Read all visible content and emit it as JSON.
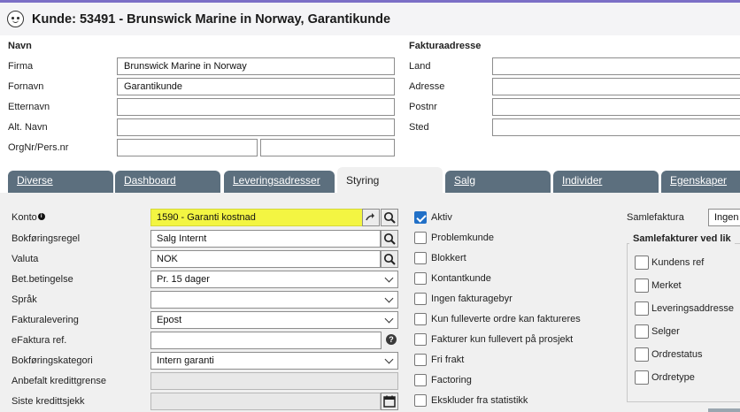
{
  "title": "Kunde: 53491 - Brunswick Marine in Norway, Garantikunde",
  "navn": {
    "heading": "Navn",
    "firma_label": "Firma",
    "firma_value": "Brunswick Marine in Norway",
    "fornavn_label": "Fornavn",
    "fornavn_value": "Garantikunde",
    "etternavn_label": "Etternavn",
    "etternavn_value": "",
    "altnavn_label": "Alt. Navn",
    "altnavn_value": "",
    "orgnr_label": "OrgNr/Pers.nr",
    "orgnr_value1": "",
    "orgnr_value2": ""
  },
  "faktura": {
    "heading": "Fakturaadresse",
    "land_label": "Land",
    "land_value": "",
    "adresse_label": "Adresse",
    "adresse_value": "",
    "postnr_label": "Postnr",
    "postnr_value": "",
    "sted_label": "Sted",
    "sted_value": ""
  },
  "tabs": [
    {
      "label": "Diverse",
      "active": false
    },
    {
      "label": "Dashboard",
      "active": false
    },
    {
      "label": "Leveringsadresser",
      "active": false
    },
    {
      "label": "Styring",
      "active": true
    },
    {
      "label": "Salg",
      "active": false
    },
    {
      "label": "Individer",
      "active": false
    },
    {
      "label": "Egenskaper",
      "active": false
    }
  ],
  "styring": {
    "konto_label": "Konto",
    "konto_value": "1590 - Garanti kostnad",
    "bokforingsregel_label": "Bokføringsregel",
    "bokforingsregel_value": "Salg Internt",
    "valuta_label": "Valuta",
    "valuta_value": "NOK",
    "betbetingelse_label": "Bet.betingelse",
    "betbetingelse_value": "Pr. 15 dager",
    "sprak_label": "Språk",
    "sprak_value": "",
    "fakturalevering_label": "Fakturalevering",
    "fakturalevering_value": "Epost",
    "efaktura_label": "eFaktura ref.",
    "efaktura_value": "",
    "bokforingskategori_label": "Bokføringskategori",
    "bokforingskategori_value": "Intern garanti",
    "anbefalt_label": "Anbefalt kredittgrense",
    "anbefalt_value": "",
    "siste_label": "Siste kredittsjekk",
    "siste_value": ""
  },
  "checkboxes": [
    {
      "label": "Aktiv",
      "checked": true
    },
    {
      "label": "Problemkunde",
      "checked": false
    },
    {
      "label": "Blokkert",
      "checked": false
    },
    {
      "label": "Kontantkunde",
      "checked": false
    },
    {
      "label": "Ingen fakturagebyr",
      "checked": false
    },
    {
      "label": "Kun fulleverte ordre kan faktureres",
      "checked": false
    },
    {
      "label": "Fakturer kun fullevert på prosjekt",
      "checked": false
    },
    {
      "label": "Fri frakt",
      "checked": false
    },
    {
      "label": "Factoring",
      "checked": false
    },
    {
      "label": "Ekskluder fra statistikk",
      "checked": false
    }
  ],
  "samlefaktura": {
    "label": "Samlefaktura",
    "value": "Ingen",
    "group_title": "Samlefakturer ved lik",
    "options": [
      "Kundens ref",
      "Merket",
      "Leveringsaddresse",
      "Selger",
      "Ordrestatus",
      "Ordretype"
    ]
  },
  "colors": {
    "tab": "#5c6f7e",
    "highlight": "#f3f542",
    "checkbox_checked": "#2170c7",
    "title_accent": "#7b6fc6"
  }
}
